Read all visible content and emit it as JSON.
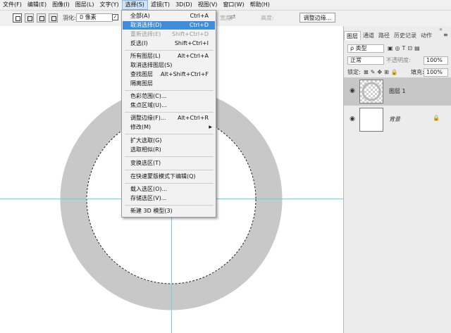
{
  "menubar": {
    "items": [
      "文件(F)",
      "编辑(E)",
      "图像(I)",
      "图层(L)",
      "文字(Y)",
      "选择(S)",
      "滤镜(T)",
      "3D(D)",
      "视图(V)",
      "窗口(W)",
      "帮助(H)"
    ],
    "active_index": 5
  },
  "options": {
    "feather_label": "羽化:",
    "feather_value": "0 像素",
    "checkbox_mark": "✓",
    "width_label": "宽度:",
    "height_label": "高度:",
    "swap_icon": "⇄",
    "refine_label": "调整边缘..."
  },
  "select_menu": {
    "items": [
      {
        "label": "全部(A)",
        "shortcut": "Ctrl+A"
      },
      {
        "label": "取消选择(D)",
        "shortcut": "Ctrl+D",
        "highlighted": true
      },
      {
        "label": "重新选择(E)",
        "shortcut": "Shift+Ctrl+D",
        "disabled": true
      },
      {
        "label": "反选(I)",
        "shortcut": "Shift+Ctrl+I"
      },
      {
        "label": "所有图层(L)",
        "shortcut": "Alt+Ctrl+A"
      },
      {
        "label": "取消选择图层(S)",
        "shortcut": ""
      },
      {
        "label": "查找图层",
        "shortcut": "Alt+Shift+Ctrl+F"
      },
      {
        "label": "隔离图层",
        "shortcut": ""
      },
      {
        "label": "色彩范围(C)...",
        "shortcut": ""
      },
      {
        "label": "焦点区域(U)...",
        "shortcut": ""
      },
      {
        "label": "调整边缘(F)...",
        "shortcut": "Alt+Ctrl+R"
      },
      {
        "label": "修改(M)",
        "shortcut": "",
        "submenu_arrow": "▶"
      },
      {
        "label": "扩大选取(G)",
        "shortcut": ""
      },
      {
        "label": "选取相似(R)",
        "shortcut": ""
      },
      {
        "label": "变换选区(T)",
        "shortcut": ""
      },
      {
        "label": "在快速蒙版模式下编辑(Q)",
        "shortcut": ""
      },
      {
        "label": "载入选区(O)...",
        "shortcut": ""
      },
      {
        "label": "存储选区(V)...",
        "shortcut": ""
      },
      {
        "label": "新建 3D 模型(3)",
        "shortcut": ""
      }
    ]
  },
  "panel": {
    "tabs": [
      "图层",
      "通道",
      "路径",
      "历史记录",
      "动作"
    ],
    "collapse_icon": "«",
    "menu_icon": "≡",
    "filter_label": "ρ 类型",
    "blend_mode": "正常",
    "opacity_label": "不透明度:",
    "opacity_value": "100%",
    "lock_label": "锁定:",
    "fill_label": "填充:",
    "fill_value": "100%",
    "eye_icon": "◉",
    "lock_icon": "🔒",
    "layers": [
      {
        "name": "图层 1",
        "selected": true
      },
      {
        "name": "背景",
        "locked": true
      }
    ]
  },
  "colors": {
    "ring": "#c8c8c8",
    "guide": "#60d6e6",
    "menu_highlight": "#3d8ddb",
    "selected_layer": "#c7c7c7"
  }
}
